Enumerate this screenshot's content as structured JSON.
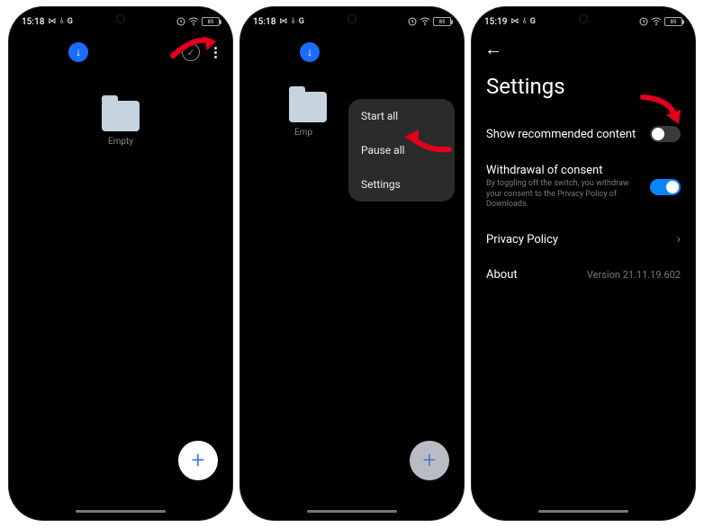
{
  "status": {
    "time_a": "15:18",
    "time_b": "15:18",
    "time_c": "15:19",
    "carrier_icons": "⋈ ⫰ G",
    "battery": "85"
  },
  "screen1": {
    "folder_label": "Empty",
    "fab_symbol": "+"
  },
  "screen2": {
    "folder_label": "Emp",
    "menu": {
      "start_all": "Start all",
      "pause_all": "Pause all",
      "settings": "Settings"
    },
    "fab_symbol": "+"
  },
  "screen3": {
    "title": "Settings",
    "rows": {
      "recommended": "Show recommended content",
      "withdrawal_label": "Withdrawal of consent",
      "withdrawal_sub": "By toggling off the switch, you withdraw your consent to the Privacy Policy of Downloads.",
      "privacy": "Privacy Policy",
      "about": "About",
      "about_value": "Version 21.11.19.602"
    }
  }
}
